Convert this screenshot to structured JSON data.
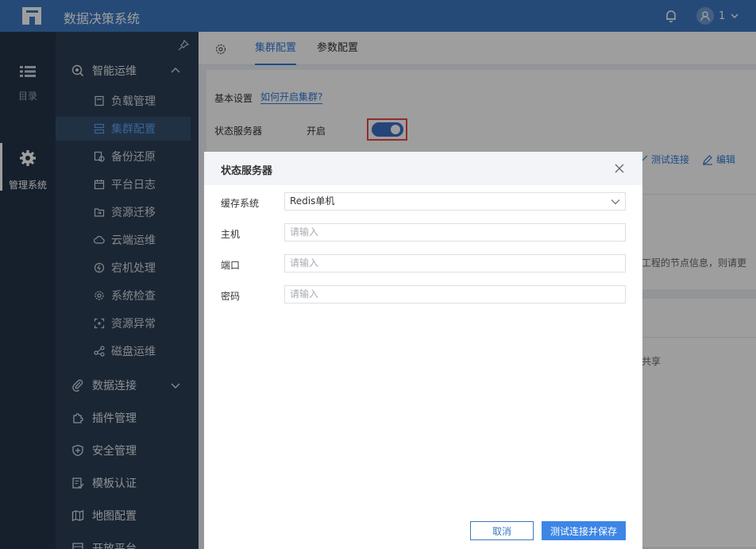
{
  "header": {
    "title": "数据决策系统",
    "user": "1"
  },
  "rail": {
    "items": [
      {
        "label": "目录"
      },
      {
        "label": "管理系统"
      }
    ]
  },
  "sidebar": {
    "groups": [
      {
        "label": "智能运维"
      },
      {
        "label": "数据连接"
      },
      {
        "label": "插件管理"
      },
      {
        "label": "安全管理"
      },
      {
        "label": "模板认证"
      },
      {
        "label": "地图配置"
      },
      {
        "label": "开放平台"
      }
    ],
    "items": [
      {
        "label": "负载管理"
      },
      {
        "label": "集群配置"
      },
      {
        "label": "备份还原"
      },
      {
        "label": "平台日志"
      },
      {
        "label": "资源迁移"
      },
      {
        "label": "云端运维"
      },
      {
        "label": "宕机处理"
      },
      {
        "label": "系统检查"
      },
      {
        "label": "资源异常"
      },
      {
        "label": "磁盘运维"
      }
    ]
  },
  "tabs": [
    {
      "label": "集群配置"
    },
    {
      "label": "参数配置"
    }
  ],
  "panel": {
    "basic_label": "基本设置",
    "help_link": "如何开启集群?",
    "state_label": "状态服务器",
    "state_value": "开启",
    "toggle_on": true,
    "test_link": "测试连接",
    "edit_link": "编辑",
    "node_info": "工程的节点信息，则请更",
    "share_text": "共享"
  },
  "modal": {
    "title": "状态服务器",
    "fields": [
      {
        "label": "缓存系统",
        "value": "Redis单机"
      },
      {
        "label": "主机",
        "placeholder": "请输入"
      },
      {
        "label": "端口",
        "placeholder": "请输入"
      },
      {
        "label": "密码",
        "placeholder": "请输入"
      }
    ],
    "cancel": "取消",
    "save": "测试连接并保存"
  }
}
